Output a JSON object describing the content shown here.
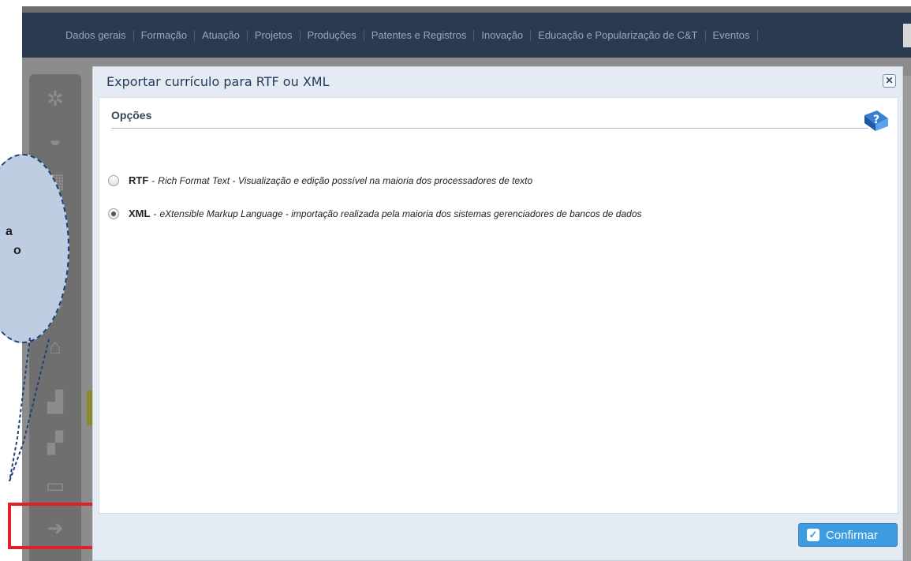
{
  "nav": {
    "items": [
      "Dados gerais",
      "Formação",
      "Atuação",
      "Projetos",
      "Produções",
      "Patentes e Registros",
      "Inovação",
      "Educação e Popularização de C&T",
      "Eventos"
    ]
  },
  "sidebar": {
    "icons": [
      "network-icon",
      "bowl-icon",
      "calendar-user-icon",
      "document-icon",
      "head-gear-icon",
      "institution-icon",
      "file-link-icon",
      "file-icon",
      "print-icon",
      "export-icon"
    ]
  },
  "bubble": {
    "lines": [
      "a",
      "o"
    ]
  },
  "dialog": {
    "title": "Exportar currículo para RTF ou XML",
    "close_glyph": "✕",
    "section_title": "Opções",
    "options": [
      {
        "name": "RTF",
        "separator": "-",
        "description": "Rich Format Text - Visualização e edição possível na maioria dos processadores de texto",
        "selected": false
      },
      {
        "name": "XML",
        "separator": "-",
        "description": "eXtensible Markup Language - importação realizada pela maioria dos sistemas gerenciadores de bancos de dados",
        "selected": true
      }
    ],
    "confirm_label": "Confirmar"
  },
  "colors": {
    "navbar": "#2a3a50",
    "dialog_bg": "#e4ebf3",
    "confirm": "#3d9be0",
    "highlight": "#e0212b",
    "bubble": "#bfcde2"
  }
}
